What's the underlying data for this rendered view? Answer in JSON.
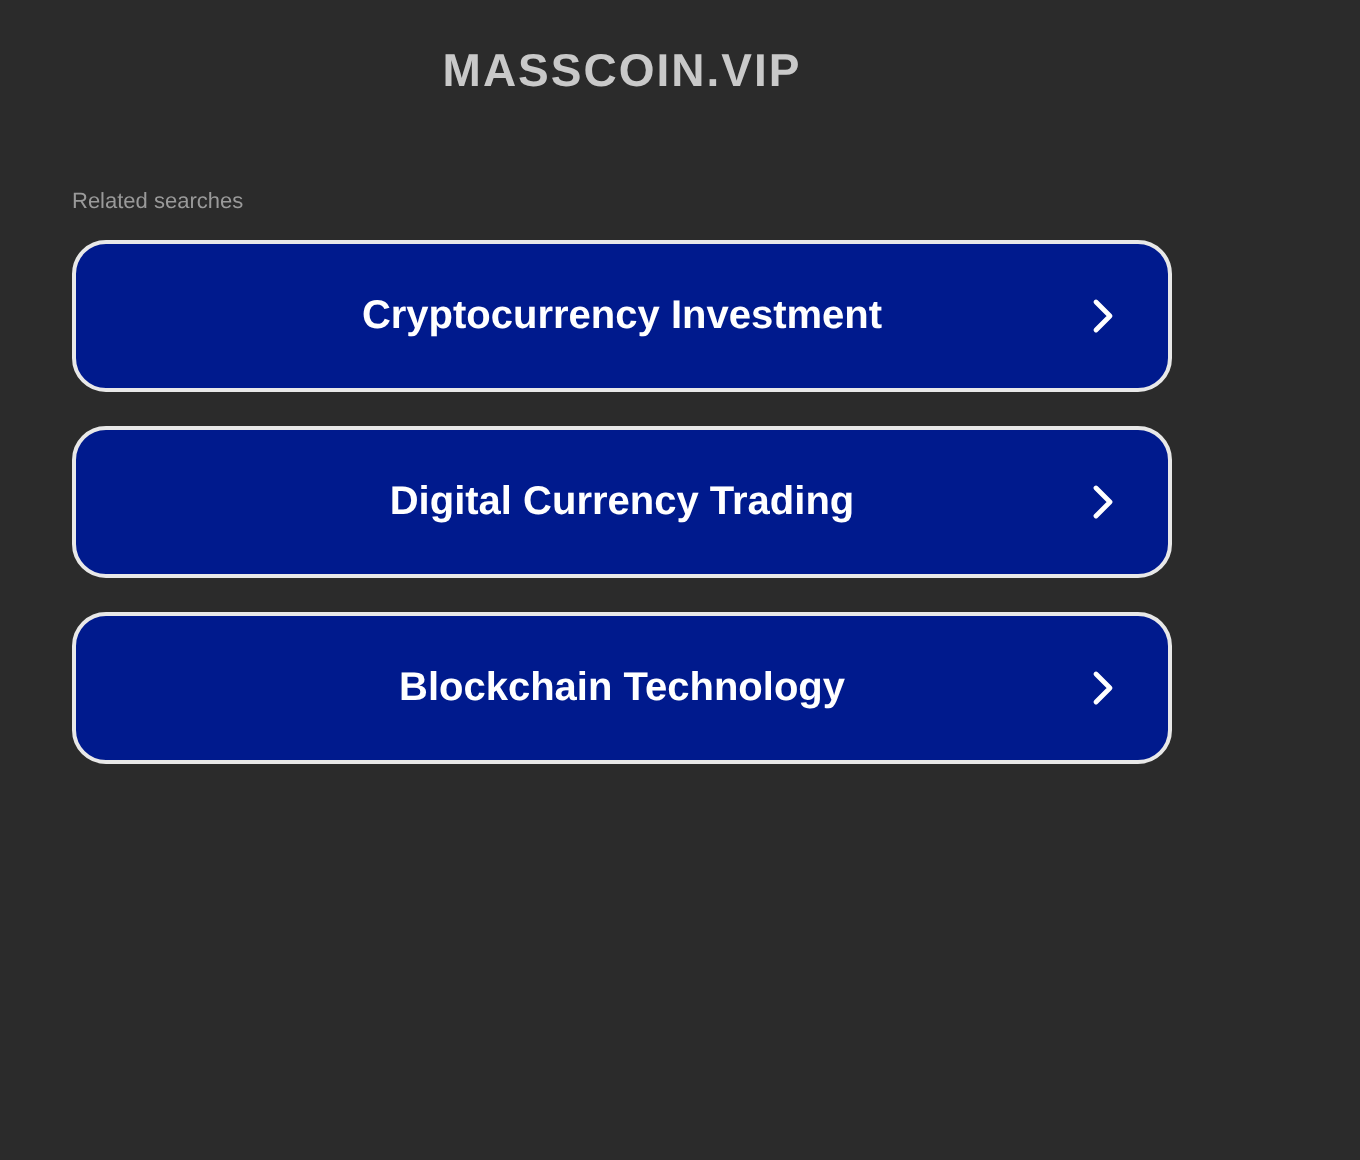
{
  "site_title": "MASSCOIN.VIP",
  "related_heading": "Related searches",
  "links": [
    {
      "label": "Cryptocurrency Investment"
    },
    {
      "label": "Digital Currency Trading"
    },
    {
      "label": "Blockchain Technology"
    }
  ]
}
